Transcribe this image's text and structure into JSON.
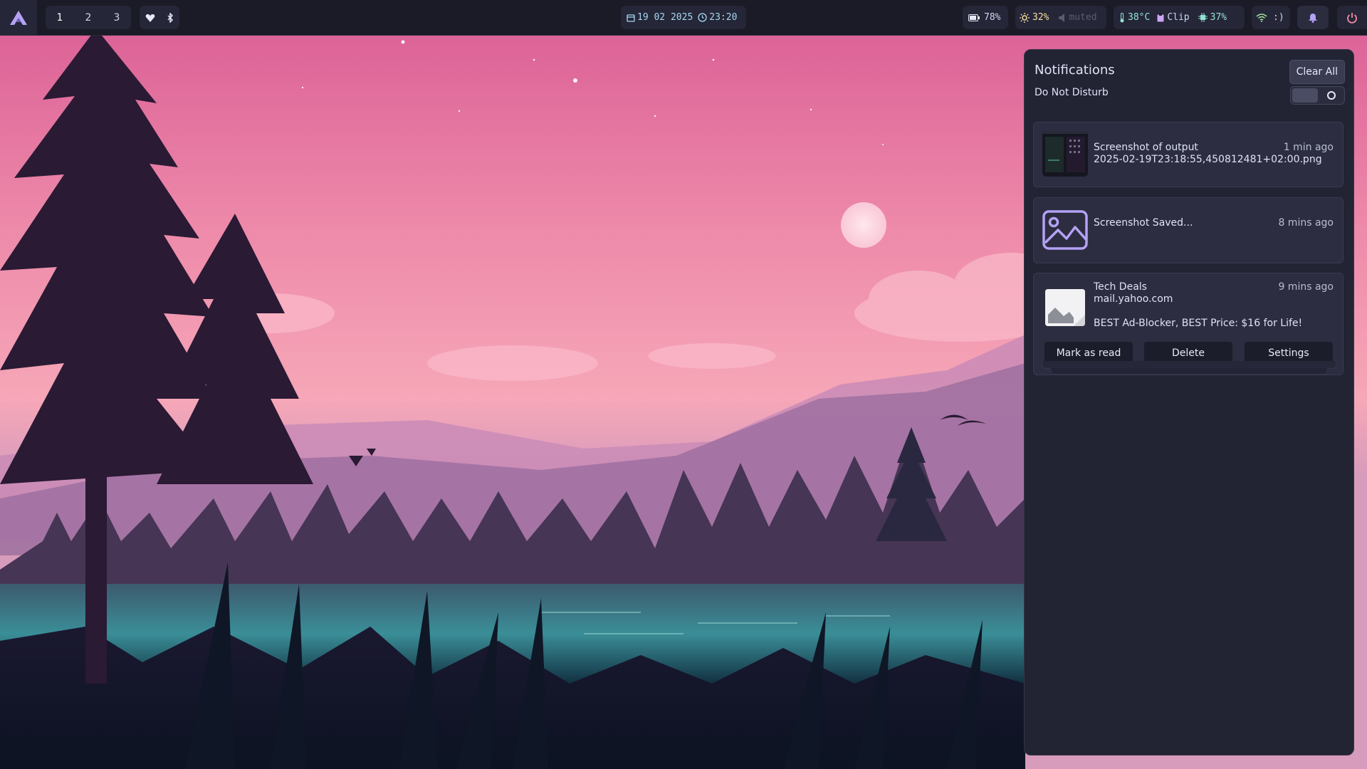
{
  "bar": {
    "workspaces": [
      "1",
      "2",
      "3"
    ],
    "active_workspace": "1",
    "date": "19 02 2025",
    "time": "23:20",
    "battery": "78%",
    "brightness": "32%",
    "volume": "muted",
    "temperature": "38°C",
    "clipboard": "Clip",
    "cpu": "37%",
    "network": ":)",
    "icons": [
      "arch-logo-icon",
      "heart-icon",
      "bluetooth-icon",
      "calendar-icon",
      "clock-icon",
      "battery-icon",
      "brightness-icon",
      "speaker-muted-icon",
      "thermometer-icon",
      "clipboard-icon",
      "cpu-icon",
      "wifi-icon",
      "bell-icon",
      "power-icon"
    ]
  },
  "notifications": {
    "title": "Notifications",
    "clear_all_label": "Clear All",
    "dnd_label": "Do Not Disturb",
    "dnd_enabled": false,
    "items": [
      {
        "title": "Screenshot of output",
        "body": "2025-02-19T23:18:55,450812481+02:00.png",
        "time": "1 min ago",
        "icon": "screenshot-thumbnail"
      },
      {
        "title": "Screenshot Saved...",
        "time": "8 mins ago",
        "icon": "image-icon"
      },
      {
        "title": "Tech Deals",
        "subtitle": "mail.yahoo.com",
        "body": "BEST Ad-Blocker, BEST Price: $16 for Life!",
        "time": "9 mins ago",
        "icon": "mail-image-icon",
        "actions": [
          "Mark as read",
          "Delete",
          "Settings"
        ]
      }
    ]
  },
  "colors": {
    "bar_bg": "#1a1b26",
    "panel_bg": "#222333",
    "card_bg": "#2c2d40",
    "accent_purple": "#b4a2f5",
    "battery_yellow": "#f5e0a0",
    "temp_teal": "#94e2d5"
  }
}
